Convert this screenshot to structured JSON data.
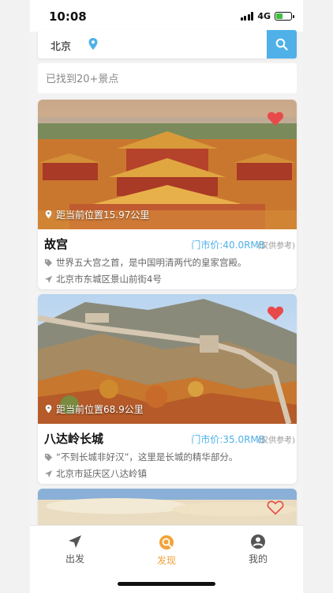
{
  "status": {
    "time": "10:08",
    "network": "4G"
  },
  "search": {
    "city": "北京"
  },
  "found_text": "已找到20+景点",
  "accent": "#4fb1e8",
  "active_color": "#f2a33a",
  "heart_color": "#e84a4a",
  "cards": [
    {
      "title": "故宫",
      "distance": "距当前位置15.97公里",
      "price": "门市价:40.0RMB",
      "price_note": "(仅供参考)",
      "description": "世界五大宫之首，是中国明清两代的皇家宫殿。",
      "address": "北京市东城区景山前街4号",
      "favorited": true
    },
    {
      "title": "八达岭长城",
      "distance": "距当前位置68.9公里",
      "price": "门市价:35.0RMB",
      "price_note": "(仅供参考)",
      "description": "“不到长城非好汉”，这里是长城的精华部分。",
      "address": "北京市延庆区八达岭镇",
      "favorited": true
    },
    {
      "favorited": false
    }
  ],
  "tabs": [
    {
      "label": "出发",
      "icon": "navigation-arrow-icon",
      "active": false
    },
    {
      "label": "发现",
      "icon": "discover-search-icon",
      "active": true
    },
    {
      "label": "我的",
      "icon": "user-icon",
      "active": false
    }
  ]
}
